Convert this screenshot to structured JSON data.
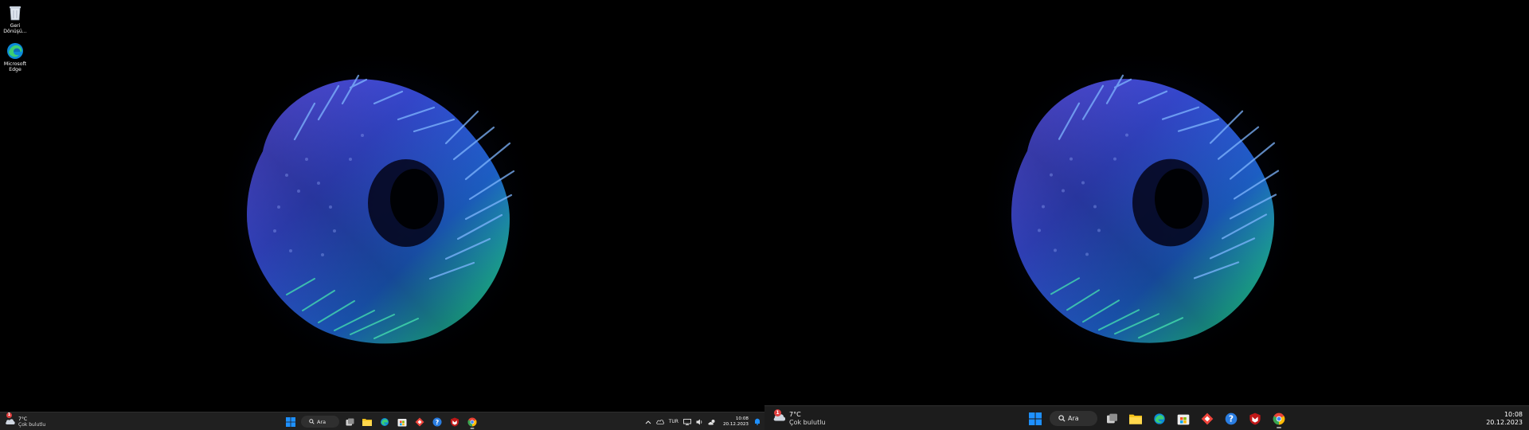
{
  "desktop": {
    "icons": [
      {
        "name": "recycle-bin",
        "label": "Geri Dönüşü..."
      },
      {
        "name": "edge",
        "label": "Microsoft Edge"
      }
    ]
  },
  "weather": {
    "temp": "7°C",
    "condition": "Çok bulutlu",
    "badge": "1"
  },
  "search": {
    "label": "Ara"
  },
  "tray": {
    "language": "TUR"
  },
  "clock": {
    "time": "10:08",
    "date": "20.12.2023"
  },
  "taskbar_apps": [
    "task-view",
    "file-explorer",
    "microsoft-edge",
    "microsoft-store",
    "anydesk",
    "help",
    "mcafee",
    "google-chrome"
  ],
  "colors": {
    "taskbar_left": "#202020",
    "taskbar_right": "#1c1c1c",
    "windows_blue": "#1e90ff",
    "chrome_red": "#ea4335",
    "chrome_green": "#34a853",
    "chrome_yellow": "#fbbc05",
    "chrome_blue": "#4285f4",
    "explorer_yellow": "#f4c21b",
    "anydesk_red": "#ef443b",
    "mcafee_red": "#c01818",
    "help_blue": "#2a7de1"
  }
}
